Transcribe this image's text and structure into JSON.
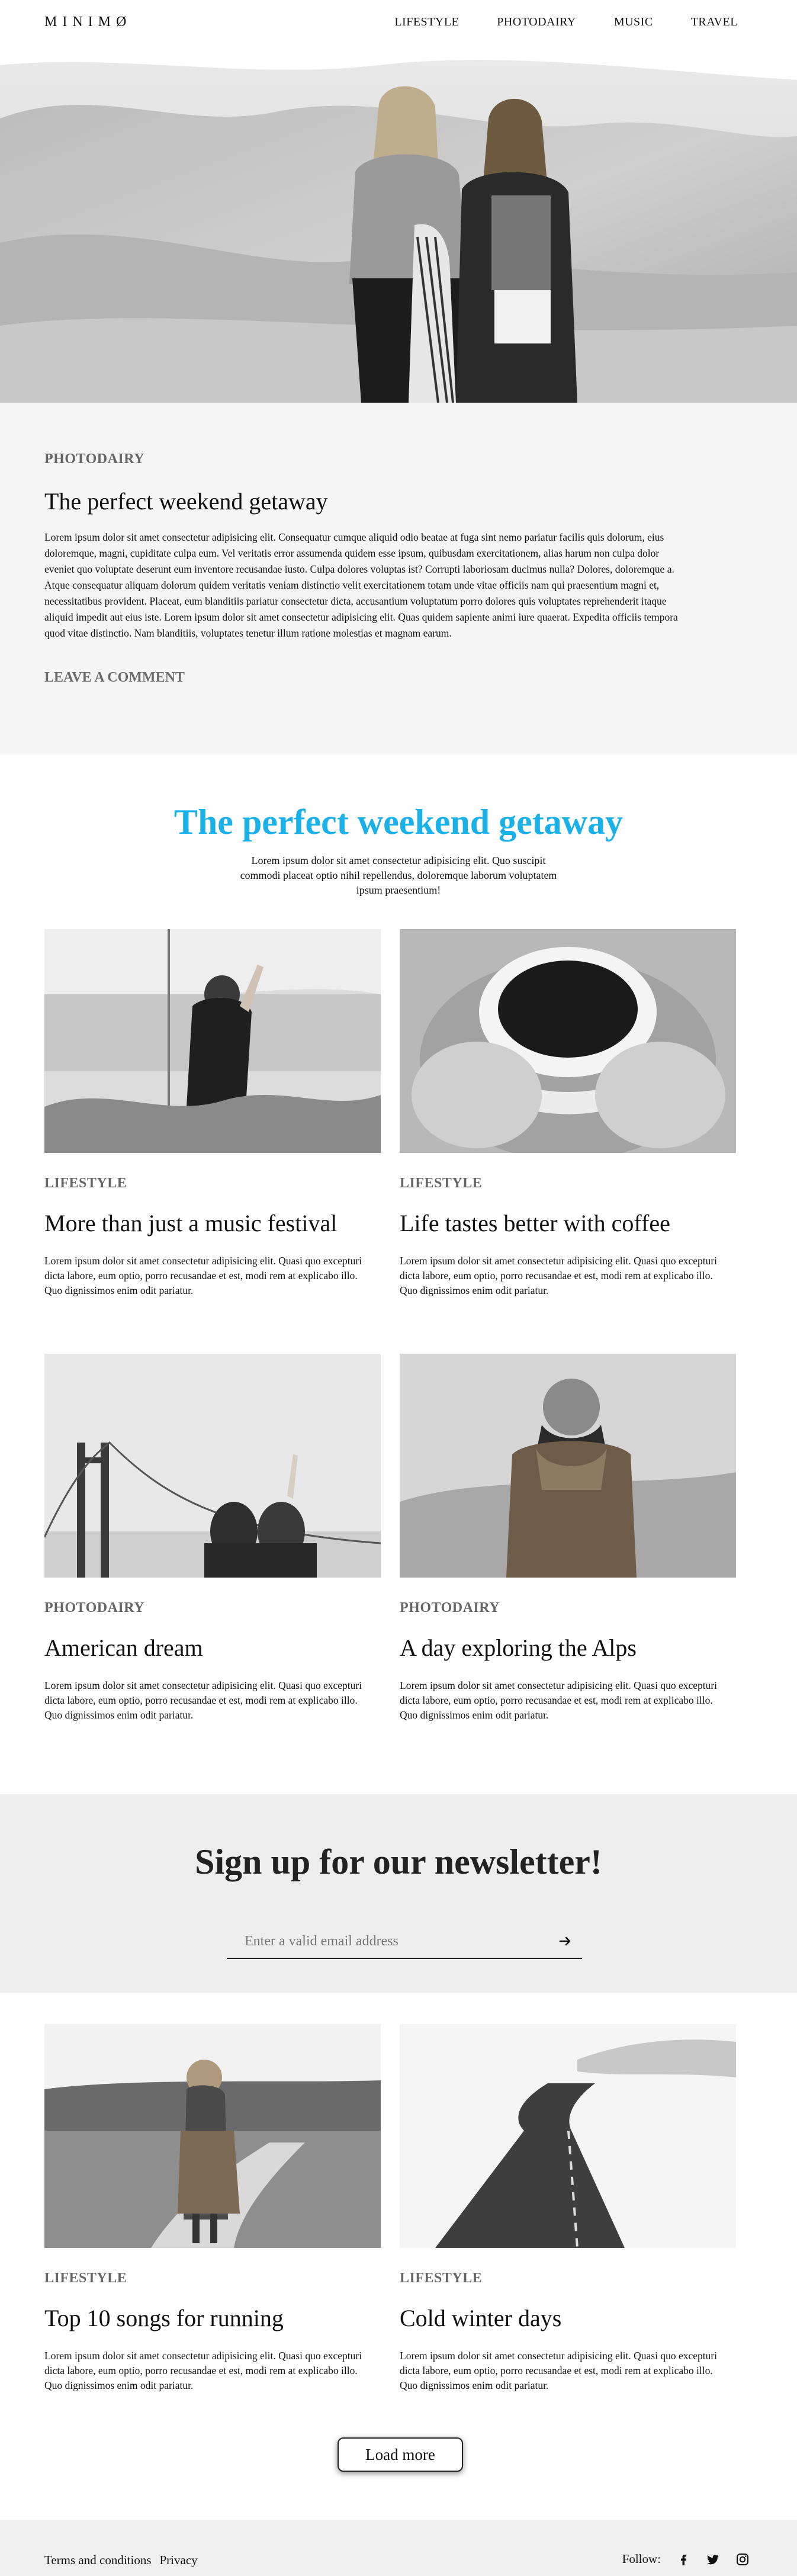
{
  "brand": {
    "logo": "MINIMØ"
  },
  "nav": {
    "items": [
      "LIFESTYLE",
      "PHOTODAIRY",
      "MUSIC",
      "TRAVEL"
    ]
  },
  "featured": {
    "category": "PHOTODAIRY",
    "title": "The perfect weekend getaway",
    "body": "Lorem ipsum dolor sit amet consectetur adipisicing elit. Consequatur cumque aliquid odio beatae at fuga sint nemo pariatur facilis quis dolorum, eius doloremque, magni, cupiditate culpa eum. Vel veritatis error assumenda quidem esse ipsum, quibusdam exercitationem, alias harum non culpa dolor eveniet quo voluptate deserunt eum inventore recusandae iusto. Culpa dolores voluptas ist? Corrupti laboriosam ducimus nulla? Dolores, doloremque a. Atque consequatur aliquam dolorum quidem veritatis veniam distinctio velit exercitationem totam unde vitae officiis nam qui praesentium magni et, necessitatibus provident. Placeat, eum blanditiis pariatur consectetur dicta, accusantium voluptatum porro dolores quis voluptates reprehenderit itaque aliquid impedit aut eius iste. Lorem ipsum dolor sit amet consectetur adipisicing elit. Quas quidem sapiente animi iure quaerat. Expedita officiis tempora quod vitae distinctio. Nam blanditiis, voluptates tenetur illum ratione molestias et magnam earum.",
    "comment_link": "LEAVE A COMMENT"
  },
  "intro": {
    "title": "The perfect weekend getaway",
    "text": "Lorem ipsum dolor sit amet consectetur adipisicing elit. Quo suscipit commodi placeat optio nihil repellendus, doloremque laborum voluptatem ipsum praesentium!",
    "title_color": "#1ab1e8"
  },
  "posts": [
    {
      "category": "LIFESTYLE",
      "title": "More than just a music festival",
      "excerpt": "Lorem ipsum dolor sit amet consectetur adipisicing elit. Quasi quo excepturi dicta labore, eum optio, porro recusandae et est, modi rem at explicabo illo. Quo dignissimos enim odit pariatur."
    },
    {
      "category": "LIFESTYLE",
      "title": "Life tastes better with coffee",
      "excerpt": "Lorem ipsum dolor sit amet consectetur adipisicing elit. Quasi quo excepturi dicta labore, eum optio, porro recusandae et est, modi rem at explicabo illo. Quo dignissimos enim odit pariatur."
    },
    {
      "category": "PHOTODAIRY",
      "title": "American dream",
      "excerpt": "Lorem ipsum dolor sit amet consectetur adipisicing elit. Quasi quo excepturi dicta labore, eum optio, porro recusandae et est, modi rem at explicabo illo. Quo dignissimos enim odit pariatur."
    },
    {
      "category": "PHOTODAIRY",
      "title": "A day exploring the Alps",
      "excerpt": "Lorem ipsum dolor sit amet consectetur adipisicing elit. Quasi quo excepturi dicta labore, eum optio, porro recusandae et est, modi rem at explicabo illo. Quo dignissimos enim odit pariatur."
    },
    {
      "category": "LIFESTYLE",
      "title": "Top 10 songs for running",
      "excerpt": "Lorem ipsum dolor sit amet consectetur adipisicing elit. Quasi quo excepturi dicta labore, eum optio, porro recusandae et est, modi rem at explicabo illo. Quo dignissimos enim odit pariatur."
    },
    {
      "category": "LIFESTYLE",
      "title": "Cold winter days",
      "excerpt": "Lorem ipsum dolor sit amet consectetur adipisicing elit. Quasi quo excepturi dicta labore, eum optio, porro recusandae et est, modi rem at explicabo illo. Quo dignissimos enim odit pariatur."
    }
  ],
  "newsletter": {
    "title": "Sign up for our newsletter!",
    "placeholder": "Enter a valid email address",
    "submit_icon": "arrow-right-icon"
  },
  "load_more": "Load more",
  "footer": {
    "links": [
      "Terms and conditions",
      "Privacy"
    ],
    "follow_label": "Follow:",
    "social_icons": [
      "facebook-icon",
      "twitter-icon",
      "instagram-icon"
    ]
  }
}
